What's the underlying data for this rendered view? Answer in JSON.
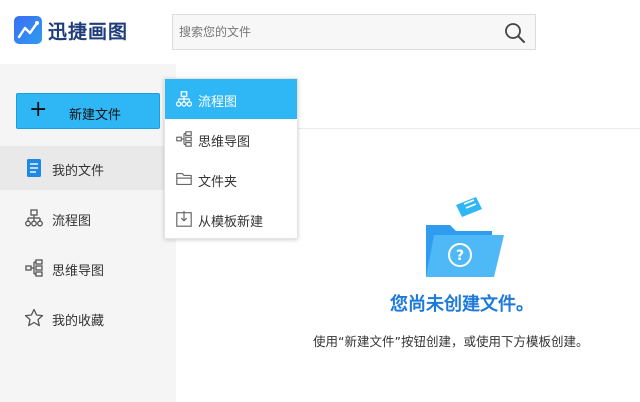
{
  "app": {
    "name": "迅捷画图"
  },
  "search": {
    "placeholder": "搜索您的文件"
  },
  "sidebar": {
    "new_file_label": "新建文件",
    "items": [
      {
        "label": "我的文件",
        "icon": "document-icon",
        "active": true
      },
      {
        "label": "流程图",
        "icon": "flowchart-icon"
      },
      {
        "label": "思维导图",
        "icon": "mindmap-icon"
      },
      {
        "label": "我的收藏",
        "icon": "star-icon"
      }
    ]
  },
  "dropdown": {
    "items": [
      {
        "label": "流程图",
        "icon": "flowchart-icon",
        "active": true
      },
      {
        "label": "思维导图",
        "icon": "mindmap-icon"
      },
      {
        "label": "文件夹",
        "icon": "folder-icon"
      },
      {
        "label": "从模板新建",
        "icon": "template-icon"
      }
    ]
  },
  "empty_state": {
    "title": "您尚未创建文件。",
    "description": "使用“新建文件”按钮创建，或使用下方模板创建。"
  },
  "colors": {
    "accent": "#2fb7f5",
    "title_blue": "#1e7ad9",
    "sidebar_bg": "#f5f5f5"
  }
}
